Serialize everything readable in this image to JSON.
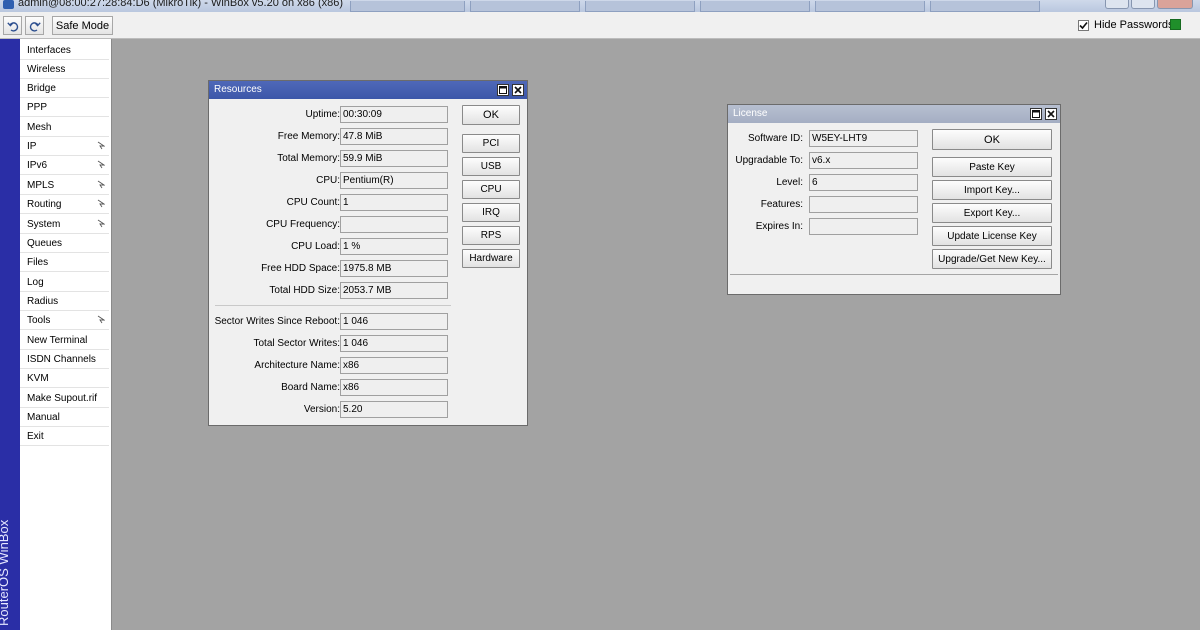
{
  "titlebar": {
    "title": "admin@08:00:27:28:84:D6 (MikroTik) - WinBox v5.20 on x86 (x86)"
  },
  "toolbar": {
    "undo_icon": "undo-icon",
    "redo_icon": "redo-icon",
    "safe_mode": "Safe Mode",
    "hide_passwords": "Hide Passwords",
    "hide_passwords_checked": true
  },
  "sidebar": {
    "brand": "RouterOS WinBox",
    "items": [
      {
        "label": "Interfaces",
        "submenu": false
      },
      {
        "label": "Wireless",
        "submenu": false
      },
      {
        "label": "Bridge",
        "submenu": false
      },
      {
        "label": "PPP",
        "submenu": false
      },
      {
        "label": "Mesh",
        "submenu": false
      },
      {
        "label": "IP",
        "submenu": true
      },
      {
        "label": "IPv6",
        "submenu": true
      },
      {
        "label": "MPLS",
        "submenu": true
      },
      {
        "label": "Routing",
        "submenu": true
      },
      {
        "label": "System",
        "submenu": true
      },
      {
        "label": "Queues",
        "submenu": false
      },
      {
        "label": "Files",
        "submenu": false
      },
      {
        "label": "Log",
        "submenu": false
      },
      {
        "label": "Radius",
        "submenu": false
      },
      {
        "label": "Tools",
        "submenu": true
      },
      {
        "label": "New Terminal",
        "submenu": false
      },
      {
        "label": "ISDN Channels",
        "submenu": false
      },
      {
        "label": "KVM",
        "submenu": false
      },
      {
        "label": "Make Supout.rif",
        "submenu": false
      },
      {
        "label": "Manual",
        "submenu": false
      },
      {
        "label": "Exit",
        "submenu": false
      }
    ]
  },
  "resources": {
    "title": "Resources",
    "fields": [
      {
        "label": "Uptime:",
        "value": "00:30:09"
      },
      {
        "label": "Free Memory:",
        "value": "47.8 MiB"
      },
      {
        "label": "Total Memory:",
        "value": "59.9 MiB"
      },
      {
        "label": "CPU:",
        "value": "Pentium(R)"
      },
      {
        "label": "CPU Count:",
        "value": "1"
      },
      {
        "label": "CPU Frequency:",
        "value": ""
      },
      {
        "label": "CPU Load:",
        "value": "1 %"
      },
      {
        "label": "Free HDD Space:",
        "value": "1975.8 MB"
      },
      {
        "label": "Total HDD Size:",
        "value": "2053.7 MB"
      },
      {
        "label": "Sector Writes Since Reboot:",
        "value": "1 046"
      },
      {
        "label": "Total Sector Writes:",
        "value": "1 046"
      },
      {
        "label": "Architecture Name:",
        "value": "x86"
      },
      {
        "label": "Board Name:",
        "value": "x86"
      },
      {
        "label": "Version:",
        "value": "5.20"
      }
    ],
    "buttons": {
      "ok": "OK",
      "pci": "PCI",
      "usb": "USB",
      "cpu": "CPU",
      "irq": "IRQ",
      "rps": "RPS",
      "hardware": "Hardware"
    }
  },
  "license": {
    "title": "License",
    "fields": [
      {
        "label": "Software ID:",
        "value": "W5EY-LHT9"
      },
      {
        "label": "Upgradable To:",
        "value": "v6.x"
      },
      {
        "label": "Level:",
        "value": "6"
      },
      {
        "label": "Features:",
        "value": ""
      },
      {
        "label": "Expires In:",
        "value": ""
      }
    ],
    "buttons": {
      "ok": "OK",
      "paste_key": "Paste Key",
      "import_key": "Import Key...",
      "export_key": "Export Key...",
      "update_license_key": "Update License Key",
      "upgrade_get_new_key": "Upgrade/Get New Key..."
    }
  }
}
